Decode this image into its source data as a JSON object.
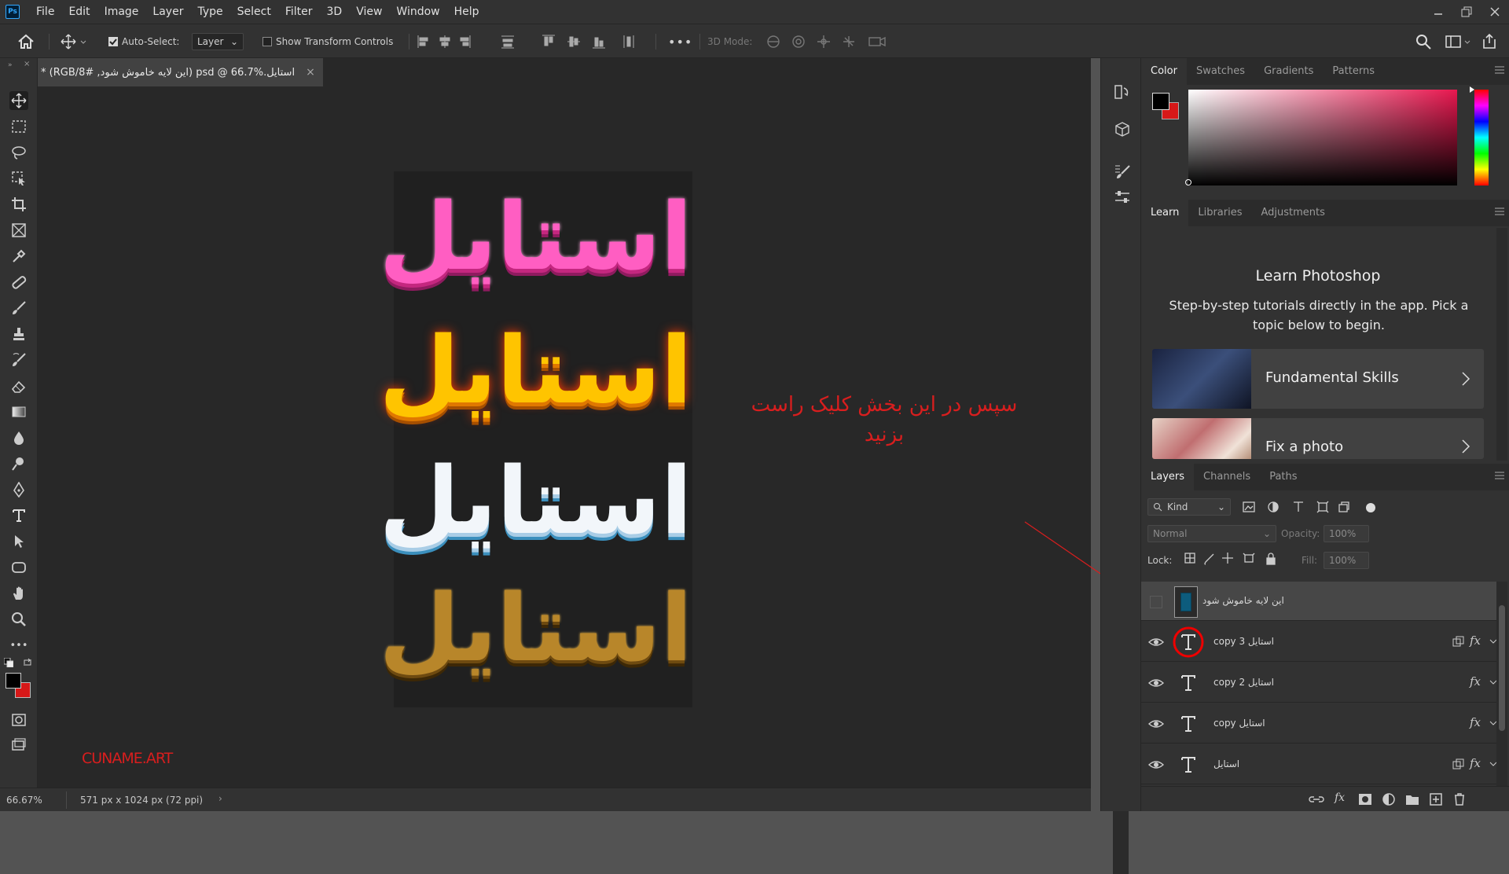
{
  "app": {
    "logo": "Ps"
  },
  "menu": [
    "File",
    "Edit",
    "Image",
    "Layer",
    "Type",
    "Select",
    "Filter",
    "3D",
    "View",
    "Window",
    "Help"
  ],
  "options": {
    "auto_select_label": "Auto-Select:",
    "auto_select_checked": true,
    "layer_dropdown": "Layer",
    "transform_label": "Show Transform Controls",
    "mode_label": "3D Mode:",
    "more": "•••"
  },
  "document": {
    "tab_title": "استایل.psd @ 66.7% (این لایه خاموش شود, RGB/8#) *"
  },
  "canvas": {
    "words": [
      "استایل",
      "استایل",
      "استایل",
      "استایل"
    ]
  },
  "annotation": {
    "line1": "سپس در این بخش کلیک راست",
    "line2": "بزنید"
  },
  "watermark": "CUNAME.ART",
  "status": {
    "zoom": "66.67%",
    "doc_info": "571 px x 1024 px (72 ppi)"
  },
  "color_panel": {
    "tabs": [
      "Color",
      "Swatches",
      "Gradients",
      "Patterns"
    ],
    "foreground": "#000000",
    "background": "#d71818"
  },
  "learn_panel": {
    "tabs": [
      "Learn",
      "Libraries",
      "Adjustments"
    ],
    "title": "Learn Photoshop",
    "description": "Step-by-step tutorials directly in the app. Pick a topic below to begin.",
    "lessons": [
      {
        "title": "Fundamental Skills"
      },
      {
        "title": "Fix a photo"
      }
    ]
  },
  "layers_panel": {
    "tabs": [
      "Layers",
      "Channels",
      "Paths"
    ],
    "kind_label": "Kind",
    "blend_mode": "Normal",
    "opacity_label": "Opacity:",
    "opacity_value": "100%",
    "lock_label": "Lock:",
    "fill_label": "Fill:",
    "fill_value": "100%",
    "layers": [
      {
        "name": "این لایه خاموش شود",
        "type": "image",
        "visible": false
      },
      {
        "name": "استایل copy 3",
        "type": "text",
        "visible": true
      },
      {
        "name": "استایل copy 2",
        "type": "text",
        "visible": true
      },
      {
        "name": "استایل copy",
        "type": "text",
        "visible": true
      },
      {
        "name": "استایل",
        "type": "text",
        "visible": true
      }
    ],
    "fx_label": "fx"
  }
}
